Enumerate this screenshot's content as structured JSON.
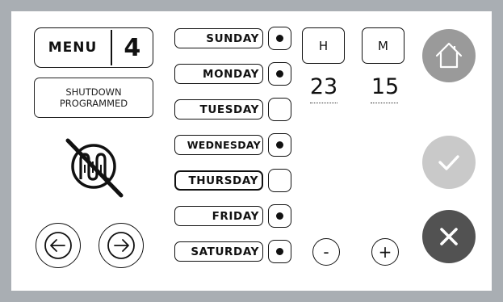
{
  "menu": {
    "label": "MENU",
    "number": "4"
  },
  "status": {
    "line1": "SHUTDOWN",
    "line2": "PROGRAMMED"
  },
  "days": [
    {
      "label": "SUNDAY",
      "enabled": true,
      "selected": false
    },
    {
      "label": "MONDAY",
      "enabled": true,
      "selected": false
    },
    {
      "label": "TUESDAY",
      "enabled": false,
      "selected": false
    },
    {
      "label": "WEDNESDAY",
      "enabled": true,
      "selected": false
    },
    {
      "label": "THURSDAY",
      "enabled": false,
      "selected": true
    },
    {
      "label": "FRIDAY",
      "enabled": true,
      "selected": false
    },
    {
      "label": "SATURDAY",
      "enabled": true,
      "selected": false
    }
  ],
  "time": {
    "hour_label": "H",
    "minute_label": "M",
    "hour": "23",
    "minute": "15"
  },
  "adjust": {
    "minus": "-",
    "plus": "+"
  },
  "icons": {
    "heater": "heater-off-icon",
    "prev": "arrow-left-circle-icon",
    "next": "arrow-right-circle-icon",
    "home": "home-icon",
    "confirm": "check-icon",
    "cancel": "close-icon"
  },
  "colors": {
    "frame": "#a9aeb3",
    "home_button": "#9a9a9a",
    "confirm_button": "#c9c9c9",
    "cancel_button": "#525252"
  }
}
